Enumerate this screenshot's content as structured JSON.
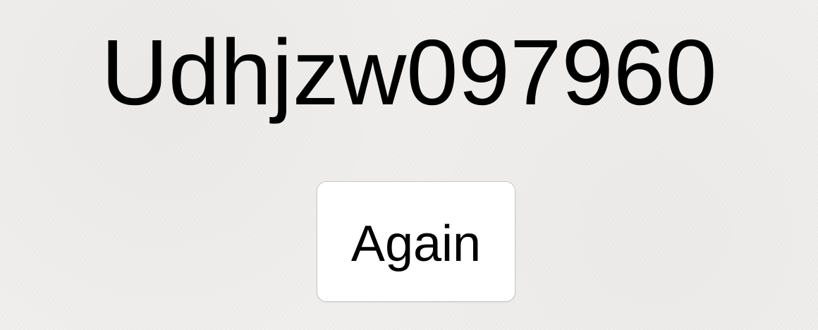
{
  "display": {
    "code": "Udhjzw097960"
  },
  "actions": {
    "again_label": "Again"
  }
}
